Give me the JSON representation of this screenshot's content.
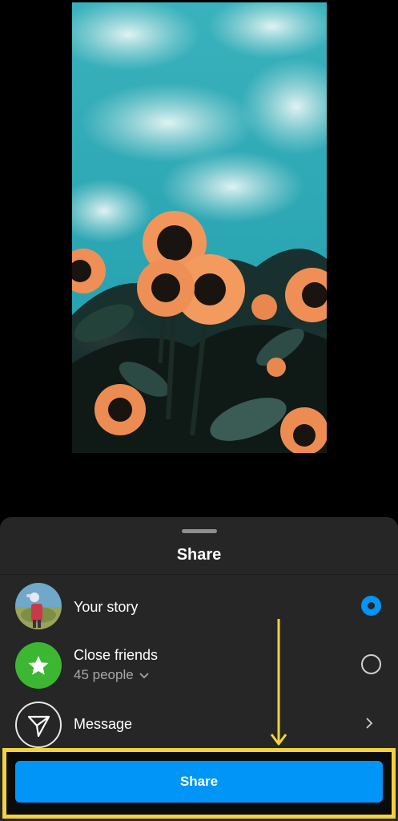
{
  "share_sheet": {
    "title": "Share",
    "options": [
      {
        "label": "Your story",
        "selected": true
      },
      {
        "label": "Close friends",
        "sublabel": "45 people",
        "selected": false
      },
      {
        "label": "Message",
        "icon": "paper-plane-icon"
      }
    ],
    "share_button_label": "Share"
  },
  "colors": {
    "accent": "#0095f6",
    "sheet_bg": "#262626",
    "close_friends_green": "#3cb732",
    "annotation_yellow": "#f3d23f"
  }
}
